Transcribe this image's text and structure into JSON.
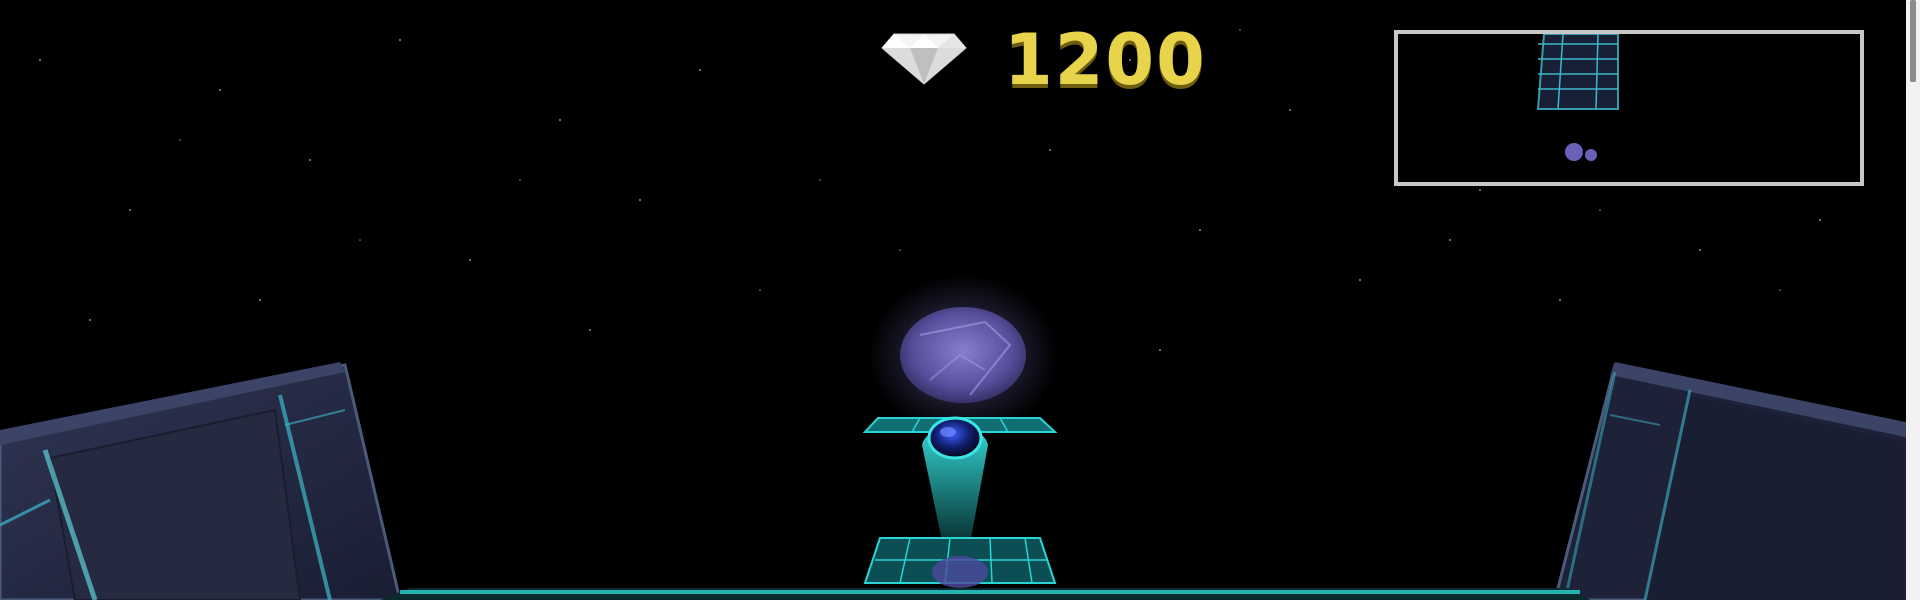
{
  "hud": {
    "score": "1200",
    "score_icon": "diamond-icon",
    "score_color": "#e8d44a"
  },
  "minimap": {
    "border_color": "#c8c8c8"
  },
  "scene": {
    "background": "#000000",
    "accent": "#2ad4d4",
    "orb_color": "#7a6fc4",
    "wall_color": "#2a2f4a"
  }
}
